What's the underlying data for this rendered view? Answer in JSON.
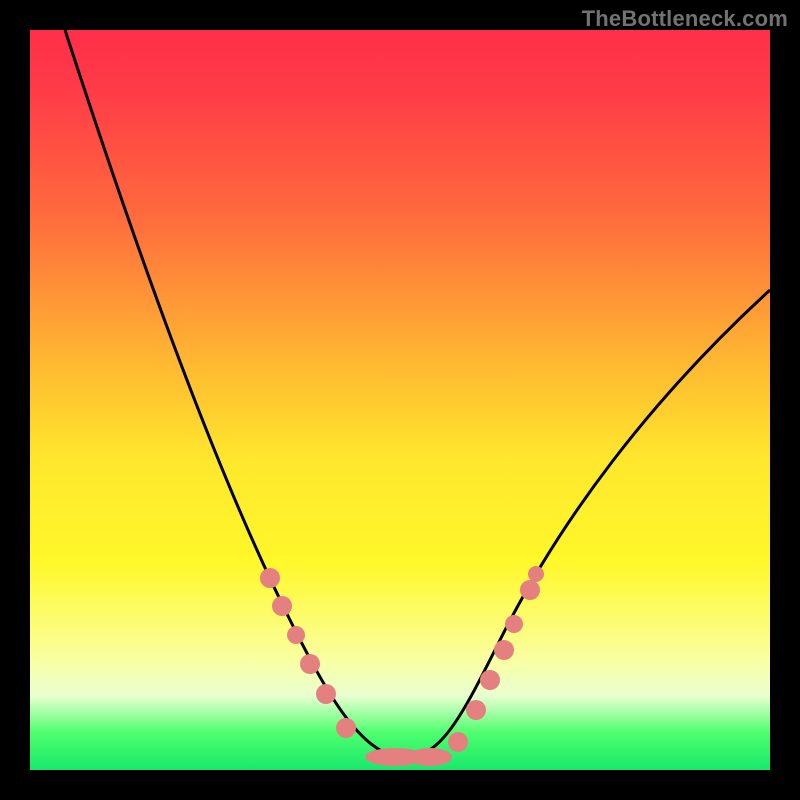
{
  "watermark": "TheBottleneck.com",
  "chart_data": {
    "type": "line",
    "title": "",
    "xlabel": "",
    "ylabel": "",
    "xlim": [
      0,
      100
    ],
    "ylim": [
      0,
      100
    ],
    "series": [
      {
        "name": "bottleneck-curve",
        "x": [
          5,
          12,
          20,
          27,
          33,
          38,
          42,
          45,
          48,
          52,
          56,
          60,
          65,
          72,
          80,
          90,
          100
        ],
        "values": [
          100,
          85,
          68,
          52,
          38,
          26,
          16,
          8,
          2,
          2,
          6,
          14,
          24,
          38,
          50,
          60,
          66
        ]
      }
    ],
    "markers": {
      "name": "data-points",
      "x": [
        32,
        34,
        37,
        39,
        42,
        44,
        47,
        50,
        53,
        56,
        59,
        60,
        62,
        64
      ],
      "values": [
        36,
        32,
        26,
        22,
        16,
        10,
        3,
        2,
        2,
        4,
        12,
        18,
        24,
        30
      ]
    }
  }
}
